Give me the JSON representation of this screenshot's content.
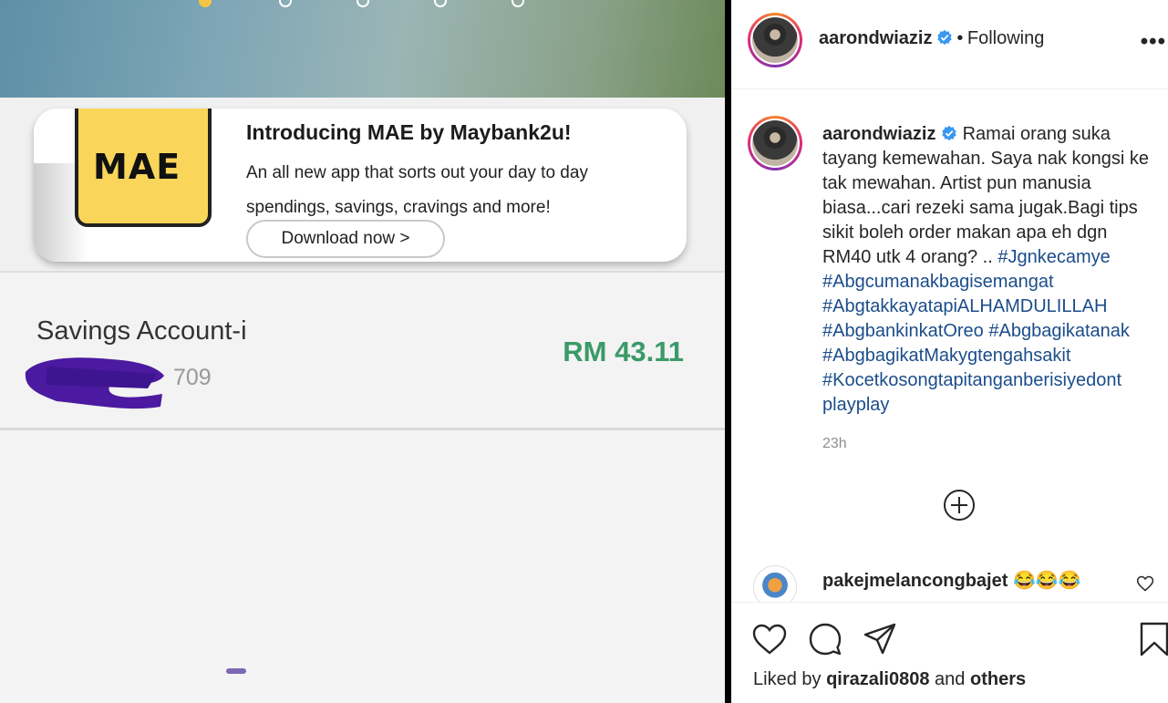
{
  "post_image": {
    "promo": {
      "logo_text": "MAE",
      "title": "Introducing MAE by Maybank2u!",
      "description": "An all new app that sorts out your day to day spendings, savings, cravings and more!",
      "button_label": "Download now >"
    },
    "account": {
      "name": "Savings Account-i",
      "number_visible": "709",
      "balance": "RM 43.11"
    },
    "colors": {
      "balance": "#3a9a68",
      "scribble": "#4b1aa0"
    }
  },
  "header": {
    "username": "aarondwiaziz",
    "separator": "•",
    "follow_status": "Following",
    "more_icon": "more-horizontal-icon"
  },
  "caption": {
    "username": "aarondwiaziz",
    "text": "Ramai orang suka tayang kemewahan. Saya nak kongsi ke tak mewahan. Artist pun manusia biasa...cari rezeki sama jugak.Bagi tips sikit boleh order makan apa eh dgn RM40 utk 4 orang? .. ",
    "hashtags": [
      "#Jgnkecamye",
      "#Abgcumanakbagisemangat",
      "#AbgtakkayatapiALHAMDULILLAH",
      "#AbgbankinkatOreo",
      "#Abgbagikatanak",
      "#AbgbagikatMakygtengahsakit",
      "#Kocetkosongtapitanganberisiyedont playplay"
    ],
    "time": "23h"
  },
  "comment": {
    "username": "pakejmelancongbajet",
    "emojis": "😂😂😂"
  },
  "actions": {
    "liked_by_prefix": "Liked by",
    "liked_by_user": "qirazali0808",
    "liked_by_and": "and",
    "liked_by_others": "others"
  }
}
